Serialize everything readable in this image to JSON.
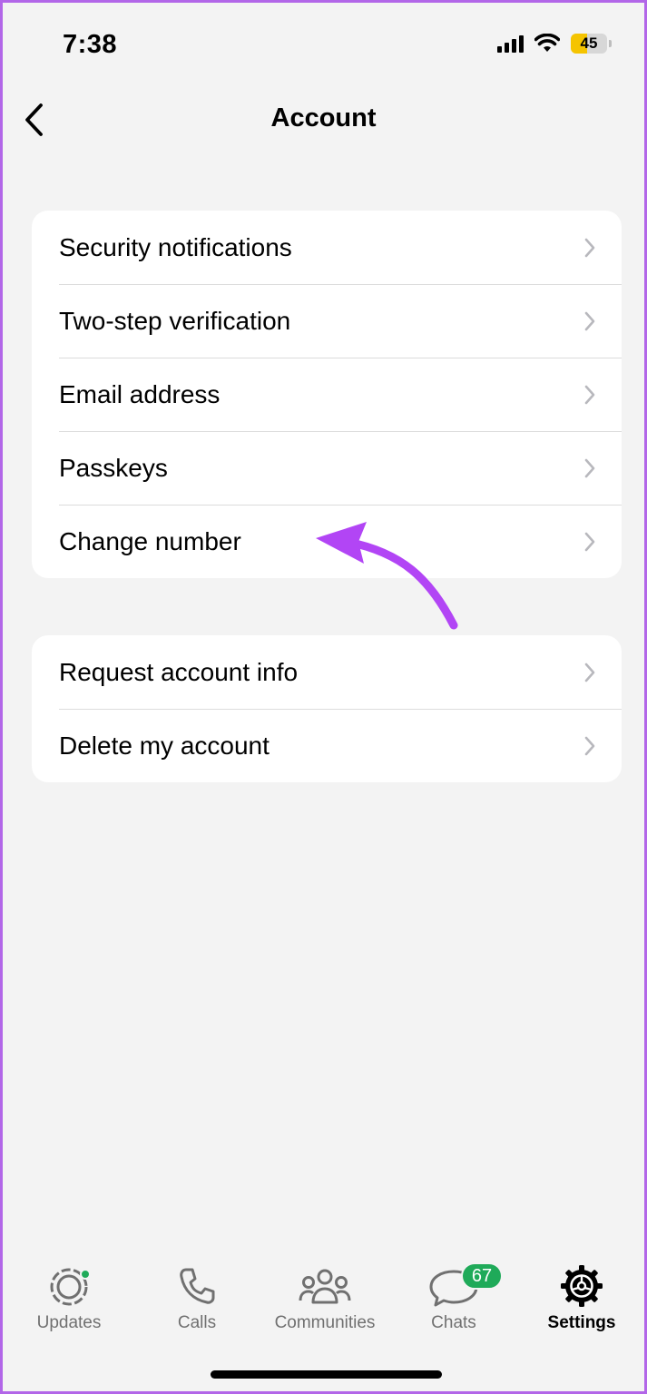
{
  "status_bar": {
    "time": "7:38",
    "battery_level": "45",
    "battery_fraction": 0.45,
    "battery_color": "#f5c400",
    "icons": [
      "signal-icon",
      "wifi-icon",
      "battery-icon"
    ]
  },
  "nav": {
    "title": "Account",
    "back_icon": "back-chevron-icon"
  },
  "groups": [
    {
      "items": [
        {
          "label": "Security notifications"
        },
        {
          "label": "Two-step verification"
        },
        {
          "label": "Email address"
        },
        {
          "label": "Passkeys"
        },
        {
          "label": "Change number"
        }
      ]
    },
    {
      "items": [
        {
          "label": "Request account info"
        },
        {
          "label": "Delete my account"
        }
      ]
    }
  ],
  "annotation": {
    "type": "curved-arrow",
    "color": "#b245f5",
    "target": "Change number"
  },
  "tabbar": {
    "tabs": [
      {
        "label": "Updates",
        "icon": "updates-icon",
        "active": false,
        "has_dot": true
      },
      {
        "label": "Calls",
        "icon": "phone-icon",
        "active": false
      },
      {
        "label": "Communities",
        "icon": "communities-icon",
        "active": false
      },
      {
        "label": "Chats",
        "icon": "chats-icon",
        "active": false,
        "badge": "67"
      },
      {
        "label": "Settings",
        "icon": "settings-gear-icon",
        "active": true
      }
    ],
    "accent_color": "#1faa59"
  }
}
